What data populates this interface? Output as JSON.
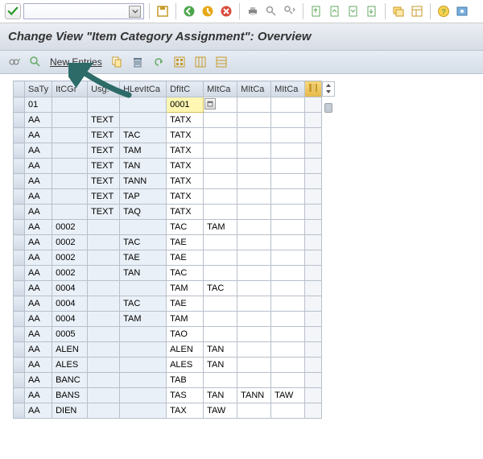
{
  "toolbar": {
    "dropdown_value": "",
    "icons": [
      "check",
      "save",
      "back",
      "exit",
      "cancel",
      "print",
      "find",
      "find-next",
      "first",
      "prev",
      "next",
      "last",
      "new-session",
      "layout",
      "help",
      "settings2"
    ]
  },
  "title": "Change View \"Item Category Assignment\": Overview",
  "app_toolbar": {
    "new_entries_label": "New Entries"
  },
  "columns": [
    "SaTy",
    "ItCGr",
    "Usg.",
    "HLevItCa",
    "DfItC",
    "MItCa",
    "MItCa",
    "MItCa"
  ],
  "col_set_icon": "column-config",
  "rows": [
    {
      "saty": "01",
      "itcgr": "",
      "usg": "",
      "hlev": "",
      "dfitc": "0001",
      "m1": "",
      "m2": "",
      "m3": "",
      "hl": true
    },
    {
      "saty": "AA",
      "itcgr": "",
      "usg": "TEXT",
      "hlev": "",
      "dfitc": "TATX",
      "m1": "",
      "m2": "",
      "m3": ""
    },
    {
      "saty": "AA",
      "itcgr": "",
      "usg": "TEXT",
      "hlev": "TAC",
      "dfitc": "TATX",
      "m1": "",
      "m2": "",
      "m3": ""
    },
    {
      "saty": "AA",
      "itcgr": "",
      "usg": "TEXT",
      "hlev": "TAM",
      "dfitc": "TATX",
      "m1": "",
      "m2": "",
      "m3": ""
    },
    {
      "saty": "AA",
      "itcgr": "",
      "usg": "TEXT",
      "hlev": "TAN",
      "dfitc": "TATX",
      "m1": "",
      "m2": "",
      "m3": ""
    },
    {
      "saty": "AA",
      "itcgr": "",
      "usg": "TEXT",
      "hlev": "TANN",
      "dfitc": "TATX",
      "m1": "",
      "m2": "",
      "m3": ""
    },
    {
      "saty": "AA",
      "itcgr": "",
      "usg": "TEXT",
      "hlev": "TAP",
      "dfitc": "TATX",
      "m1": "",
      "m2": "",
      "m3": ""
    },
    {
      "saty": "AA",
      "itcgr": "",
      "usg": "TEXT",
      "hlev": "TAQ",
      "dfitc": "TATX",
      "m1": "",
      "m2": "",
      "m3": ""
    },
    {
      "saty": "AA",
      "itcgr": "0002",
      "usg": "",
      "hlev": "",
      "dfitc": "TAC",
      "m1": "TAM",
      "m2": "",
      "m3": ""
    },
    {
      "saty": "AA",
      "itcgr": "0002",
      "usg": "",
      "hlev": "TAC",
      "dfitc": "TAE",
      "m1": "",
      "m2": "",
      "m3": ""
    },
    {
      "saty": "AA",
      "itcgr": "0002",
      "usg": "",
      "hlev": "TAE",
      "dfitc": "TAE",
      "m1": "",
      "m2": "",
      "m3": ""
    },
    {
      "saty": "AA",
      "itcgr": "0002",
      "usg": "",
      "hlev": "TAN",
      "dfitc": "TAC",
      "m1": "",
      "m2": "",
      "m3": ""
    },
    {
      "saty": "AA",
      "itcgr": "0004",
      "usg": "",
      "hlev": "",
      "dfitc": "TAM",
      "m1": "TAC",
      "m2": "",
      "m3": ""
    },
    {
      "saty": "AA",
      "itcgr": "0004",
      "usg": "",
      "hlev": "TAC",
      "dfitc": "TAE",
      "m1": "",
      "m2": "",
      "m3": ""
    },
    {
      "saty": "AA",
      "itcgr": "0004",
      "usg": "",
      "hlev": "TAM",
      "dfitc": "TAM",
      "m1": "",
      "m2": "",
      "m3": ""
    },
    {
      "saty": "AA",
      "itcgr": "0005",
      "usg": "",
      "hlev": "",
      "dfitc": "TAO",
      "m1": "",
      "m2": "",
      "m3": ""
    },
    {
      "saty": "AA",
      "itcgr": "ALEN",
      "usg": "",
      "hlev": "",
      "dfitc": "ALEN",
      "m1": "TAN",
      "m2": "",
      "m3": ""
    },
    {
      "saty": "AA",
      "itcgr": "ALES",
      "usg": "",
      "hlev": "",
      "dfitc": "ALES",
      "m1": "TAN",
      "m2": "",
      "m3": ""
    },
    {
      "saty": "AA",
      "itcgr": "BANC",
      "usg": "",
      "hlev": "",
      "dfitc": "TAB",
      "m1": "",
      "m2": "",
      "m3": ""
    },
    {
      "saty": "AA",
      "itcgr": "BANS",
      "usg": "",
      "hlev": "",
      "dfitc": "TAS",
      "m1": "TAN",
      "m2": "TANN",
      "m3": "TAW"
    },
    {
      "saty": "AA",
      "itcgr": "DIEN",
      "usg": "",
      "hlev": "",
      "dfitc": "TAX",
      "m1": "TAW",
      "m2": "",
      "m3": ""
    }
  ]
}
